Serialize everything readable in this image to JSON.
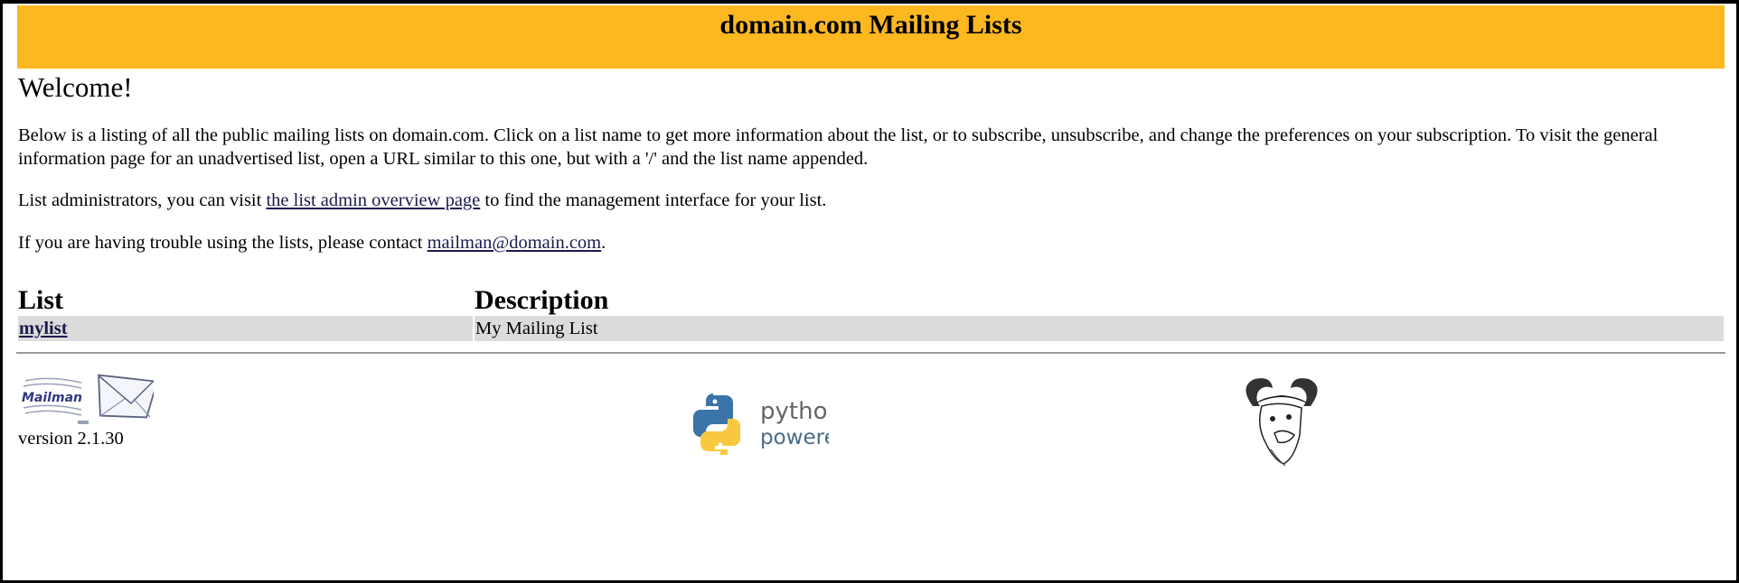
{
  "header": {
    "title": "domain.com Mailing Lists",
    "background_color": "#fdb820"
  },
  "welcome": "Welcome!",
  "intro": {
    "paragraph1": "Below is a listing of all the public mailing lists on domain.com. Click on a list name to get more information about the list, or to subscribe, unsubscribe, and change the preferences on your subscription. To visit the general information page for an unadvertised list, open a URL similar to this one, but with a '/' and the list name appended.",
    "paragraph2_before": "List administrators, you can visit ",
    "paragraph2_link": "the list admin overview page",
    "paragraph2_after": " to find the management interface for your list.",
    "paragraph3_before": "If you are having trouble using the lists, please contact ",
    "paragraph3_link": "mailman@domain.com",
    "paragraph3_after": "."
  },
  "table": {
    "headers": [
      "List",
      "Description"
    ],
    "rows": [
      {
        "name": "mylist",
        "description": "My Mailing List"
      }
    ]
  },
  "footer": {
    "mailman_logo_text": "Mailman",
    "version": "version 2.1.30",
    "python_line1": "python",
    "python_line2": "powered",
    "icons": [
      "mailman-logo-icon",
      "python-powered-icon",
      "gnu-head-icon"
    ]
  }
}
